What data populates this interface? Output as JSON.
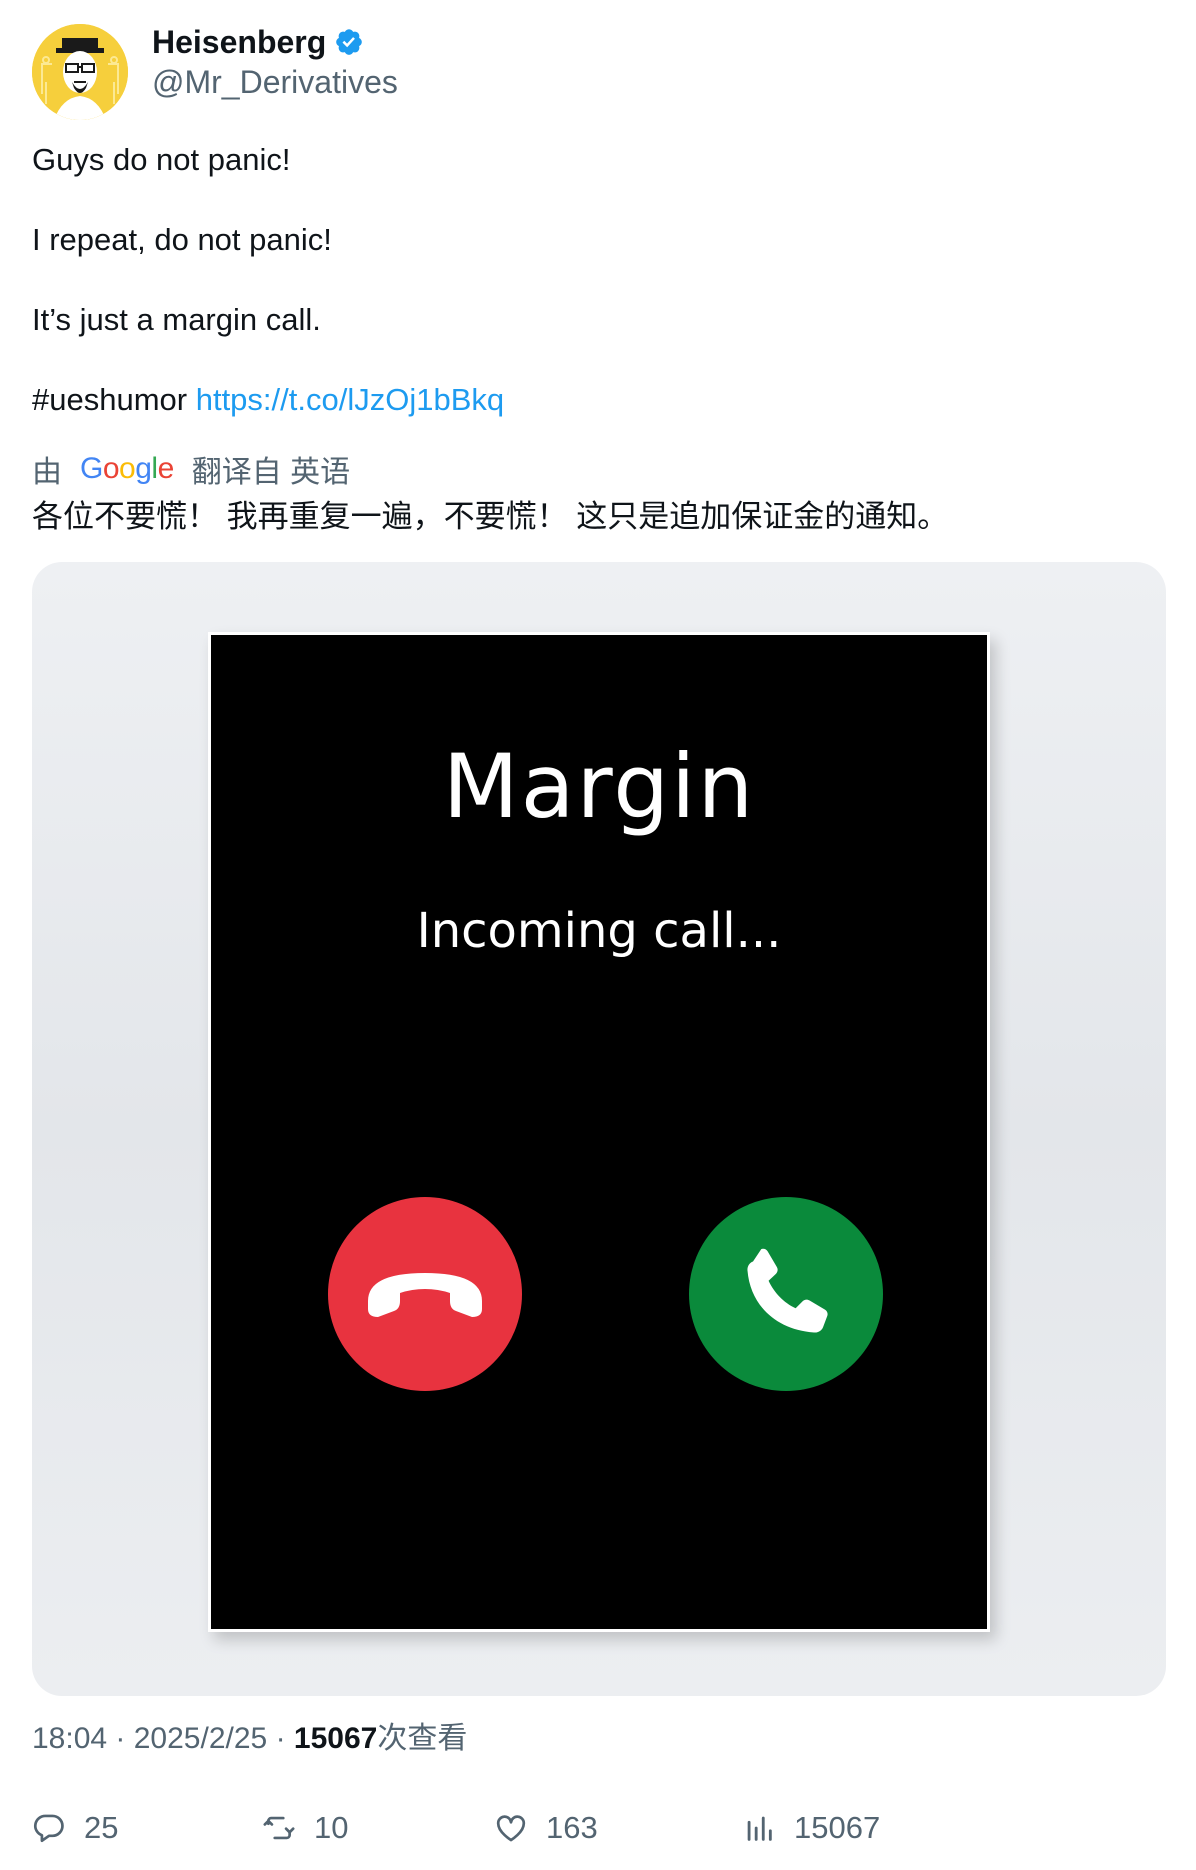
{
  "author": {
    "name": "Heisenberg",
    "handle": "@Mr_Derivatives",
    "verified": true
  },
  "tweet": {
    "lines": [
      "Guys do not panic!",
      "I repeat, do not panic!",
      "It’s just a margin call."
    ],
    "hashtag": "#ueshumor",
    "link": "https://t.co/lJzOj1bBkq"
  },
  "translation": {
    "prefix": "由",
    "provider": "Google",
    "suffix": "翻译自 英语",
    "text": "各位不要慌！ 我再重复一遍，不要慌！ 这只是追加保证金的通知。"
  },
  "media": {
    "title": "Margin",
    "subtitle": "Incoming call...",
    "decline_color": "#e8333f",
    "accept_color": "#0a8a3b"
  },
  "meta": {
    "time": "18:04",
    "date": "2025/2/25",
    "views": "15067",
    "views_label": "次查看"
  },
  "actions": {
    "replies": "25",
    "retweets": "10",
    "likes": "163",
    "views": "15067"
  },
  "colors": {
    "link": "#1d9bf0",
    "secondary_text": "#536471",
    "verified": "#1d9bf0"
  }
}
